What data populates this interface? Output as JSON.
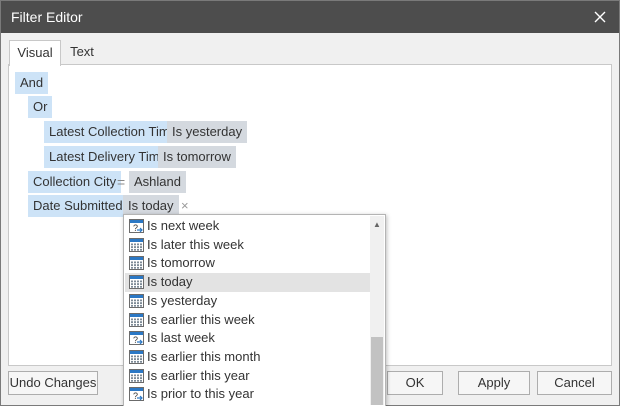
{
  "window": {
    "title": "Filter Editor"
  },
  "tabs": [
    {
      "label": "Visual"
    },
    {
      "label": "Text"
    }
  ],
  "tree": {
    "and_label": "And",
    "or_label": "Or",
    "rows": [
      {
        "field": "Latest Collection Time",
        "condition": "Is yesterday"
      },
      {
        "field": "Latest Delivery Time",
        "condition": "Is tomorrow"
      },
      {
        "field": "Collection City",
        "operator": "=",
        "value": "Ashland"
      },
      {
        "field": "Date Submitted",
        "condition": "Is today",
        "remove": "×"
      }
    ]
  },
  "dropdown": {
    "selected": "Is today",
    "items": [
      {
        "label": "Is next week",
        "icon": "calendar-question-icon"
      },
      {
        "label": "Is later this week",
        "icon": "calendar-grid-icon"
      },
      {
        "label": "Is tomorrow",
        "icon": "calendar-grid-icon"
      },
      {
        "label": "Is today",
        "icon": "calendar-grid-icon"
      },
      {
        "label": "Is yesterday",
        "icon": "calendar-grid-icon"
      },
      {
        "label": "Is earlier this week",
        "icon": "calendar-grid-icon"
      },
      {
        "label": "Is last week",
        "icon": "calendar-question-icon"
      },
      {
        "label": "Is earlier this month",
        "icon": "calendar-grid-icon"
      },
      {
        "label": "Is earlier this year",
        "icon": "calendar-grid-icon"
      },
      {
        "label": "Is prior to this year",
        "icon": "calendar-question-icon"
      }
    ]
  },
  "buttons": {
    "undo": "Undo Changes",
    "ok": "OK",
    "apply": "Apply",
    "cancel": "Cancel"
  },
  "colors": {
    "titlebar": "#4d4d4d",
    "operator_bg": "#cde3f7",
    "value_bg": "#d4d9df",
    "calendar_blue": "#2b78c5"
  }
}
